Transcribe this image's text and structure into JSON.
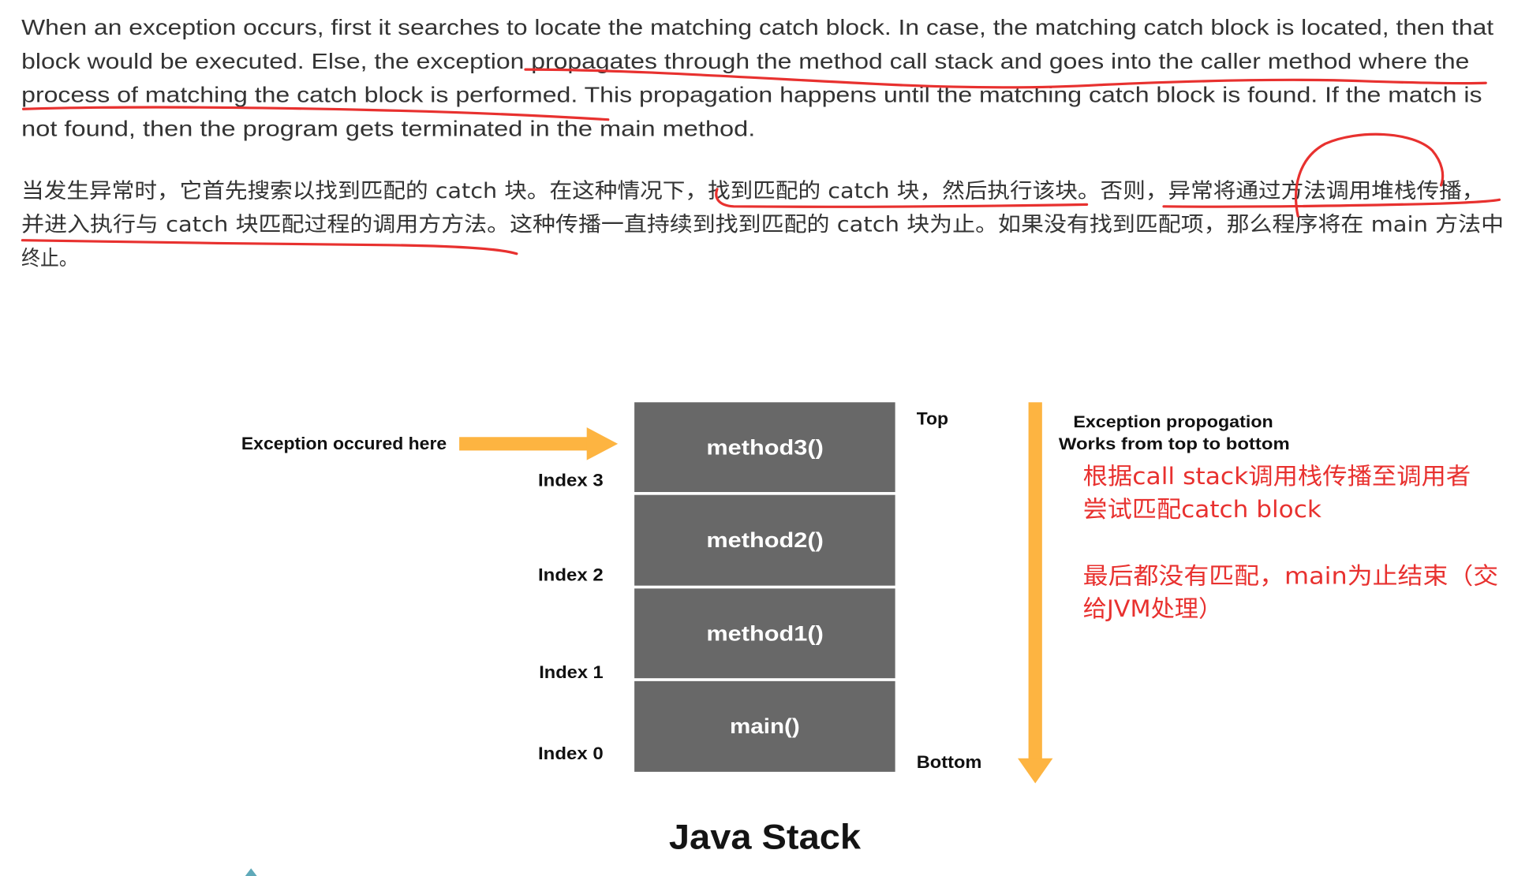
{
  "article": {
    "paragraph_en": {
      "lines": [
        "When an exception occurs, first it searches to locate the matching catch block. In case, the matching catch block is located, then that",
        "block would be executed. Else, the exception propagates through the method call stack and goes into the caller method where the",
        "process of matching the catch block is performed. This propagation happens until the matching catch block is found. If the match is",
        "not found, then the program gets terminated in the main method."
      ]
    },
    "paragraph_zh": {
      "lines": [
        "当发生异常时，它首先搜索以找到匹配的 catch 块。在这种情况下，找到匹配的 catch 块，然后执行该块。否则，异常将通过方法调用堆栈传播，",
        "并进入执行与 catch 块匹配过程的调用方方法。这种传播一直持续到找到匹配的 catch 块为止。如果没有找到匹配项，那么程序将在 main 方法中",
        "终止。"
      ]
    }
  },
  "diagram": {
    "exception_label": "Exception occured here",
    "stack_frames": [
      {
        "label": "method3()",
        "index": "Index 3"
      },
      {
        "label": "method2()",
        "index": "Index 2"
      },
      {
        "label": "method1()",
        "index": "Index 1"
      },
      {
        "label": "main()",
        "index": "Index 0"
      }
    ],
    "top_label": "Top",
    "bottom_label": "Bottom",
    "propagation_title": "Exception propogation",
    "propagation_subtitle": "Works from top to bottom",
    "caption": "Java Stack"
  },
  "handwritten_note": {
    "groups": [
      {
        "lines": [
          "根据call stack调用栈传播至调用者",
          "尝试匹配catch block"
        ]
      },
      {
        "lines": [
          "最后都没有匹配，main为止结束（交",
          "给JVM处理）"
        ]
      }
    ]
  },
  "icons": {
    "exception_pointer": "arrow-right-icon",
    "propagation_direction": "arrow-down-icon"
  },
  "colors": {
    "orange": "#FDB441",
    "annotation_red": "#E8312F",
    "stack_gray": "#686868",
    "body_text": "#333333",
    "label_text": "#111111",
    "fragment_teal": "#5FA9B9"
  }
}
